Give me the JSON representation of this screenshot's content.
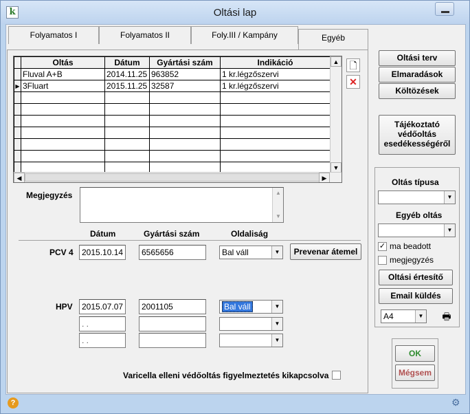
{
  "window": {
    "title": "Oltási lap"
  },
  "tabs": [
    "Folyamatos I",
    "Folyamatos II",
    "Foly.III / Kampány",
    "Egyéb"
  ],
  "grid": {
    "columns": [
      "Oltás",
      "Dátum",
      "Gyártási szám",
      "Indikáció"
    ],
    "rows": [
      [
        "Fluval A+B",
        "2014.11.25",
        "963852",
        "1 kr.légzőszervi"
      ],
      [
        "3Fluart",
        "2015.11.25",
        "32587",
        "1 kr.légzőszervi"
      ]
    ]
  },
  "note": {
    "label": "Megjegyzés",
    "value": ""
  },
  "form_headers": {
    "date": "Dátum",
    "batch": "Gyártási szám",
    "side": "Oldaliság"
  },
  "pcv4": {
    "label": "PCV 4",
    "date": "2015.10.14",
    "batch": "6565656",
    "side": "Bal váll",
    "button": "Prevenar átemel"
  },
  "hpv": {
    "label": "HPV",
    "rows": [
      {
        "date": "2015.07.07",
        "batch": "2001105",
        "side": "Bal váll"
      },
      {
        "date": " .  .",
        "batch": "",
        "side": ""
      },
      {
        "date": " .  .",
        "batch": "",
        "side": ""
      }
    ]
  },
  "varicella_label": "Varicella elleni védőoltás figyelmeztetés kikapcsolva",
  "right_panel": {
    "buttons": [
      "Oltási terv",
      "Elmaradások",
      "Költözések"
    ],
    "info_button": [
      "Tájékoztató",
      "védőoltás",
      "esedékességéről"
    ],
    "type_label": "Oltás típusa",
    "type_value": "",
    "other_label": "Egyéb oltás",
    "other_value": "",
    "ma_beadott": "ma beadott",
    "megjegyzes": "megjegyzés",
    "notice_button": "Oltási értesítő",
    "email_button": "Email küldés",
    "paper": "A4"
  },
  "ok_label": "OK",
  "cancel_label": "Mégsem",
  "icons": {
    "app": "app-icon",
    "help": "help-icon",
    "gear": "gear-icon",
    "new": "new-record-icon",
    "delete": "delete-record-icon",
    "print": "printer-icon"
  }
}
